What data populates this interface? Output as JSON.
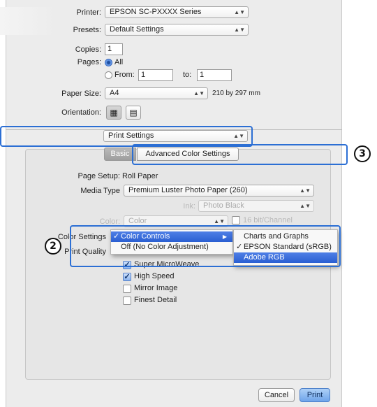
{
  "print_dialog": {
    "printer": {
      "label": "Printer:",
      "value": "EPSON SC-PXXXX Series"
    },
    "presets": {
      "label": "Presets:",
      "value": "Default Settings"
    },
    "copies": {
      "label": "Copies:",
      "value": "1"
    },
    "pages": {
      "label": "Pages:",
      "all_label": "All",
      "from_label": "From:",
      "from_value": "1",
      "to_label": "to:",
      "to_value": "1"
    },
    "paper_size": {
      "label": "Paper Size:",
      "value": "A4",
      "dimensions": "210 by 297 mm"
    },
    "orientation": {
      "label": "Orientation:"
    },
    "section_popup": "Print Settings",
    "tabs": {
      "basic": "Basic",
      "advanced": "Advanced Color Settings"
    },
    "page_setup": {
      "label": "Page Setup:",
      "value": "Roll Paper"
    },
    "media_type": {
      "label": "Media Type",
      "value": "Premium Luster Photo Paper (260)"
    },
    "ink": {
      "label": "Ink:",
      "value": "Photo Black"
    },
    "color": {
      "label": "Color:",
      "value": "Color",
      "bit_label": "16 bit/Channel"
    },
    "color_settings": {
      "label": "Color Settings"
    },
    "print_quality": {
      "label": "Print Quality"
    },
    "checkboxes": [
      {
        "label": "Super MicroWeave",
        "checked": true
      },
      {
        "label": "High Speed",
        "checked": true
      },
      {
        "label": "Mirror Image",
        "checked": false
      },
      {
        "label": "Finest Detail",
        "checked": false
      }
    ],
    "color_menu": {
      "items": [
        "Color Controls",
        "Off (No Color Adjustment)"
      ]
    },
    "color_submenu": {
      "items": [
        "Charts and Graphs",
        "EPSON Standard (sRGB)",
        "Adobe RGB"
      ]
    },
    "buttons": {
      "cancel": "Cancel",
      "print": "Print"
    }
  },
  "callouts": {
    "two": "2",
    "three": "3"
  },
  "colors": {
    "callout_border": "#2c6fd4",
    "menu_highlight": "#2a5fd2"
  }
}
